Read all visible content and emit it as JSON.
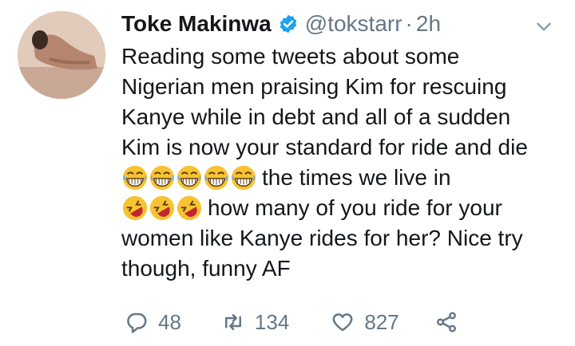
{
  "tweet": {
    "author_name": "Toke Makinwa",
    "handle": "@tokstarr",
    "separator": "·",
    "time": "2h",
    "lines": [
      "Reading some tweets about some",
      "Nigerian men praising Kim for rescuing",
      "Kanye while in debt and all of a sudden",
      "Kim is now your standard for ride and die",
      "the times we live in",
      "how many of you ride for your",
      "women like Kanye rides for her? Nice try",
      "though, funny AF"
    ],
    "emoji": {
      "laughing_crying": "face-with-tears-of-joy",
      "rofl": "rolling-on-the-floor-laughing"
    }
  },
  "actions": {
    "replies": "48",
    "retweets": "134",
    "likes": "827"
  },
  "colors": {
    "text": "#14171a",
    "muted": "#657786",
    "verified": "#1da1f2",
    "emoji": "#f8c332"
  }
}
